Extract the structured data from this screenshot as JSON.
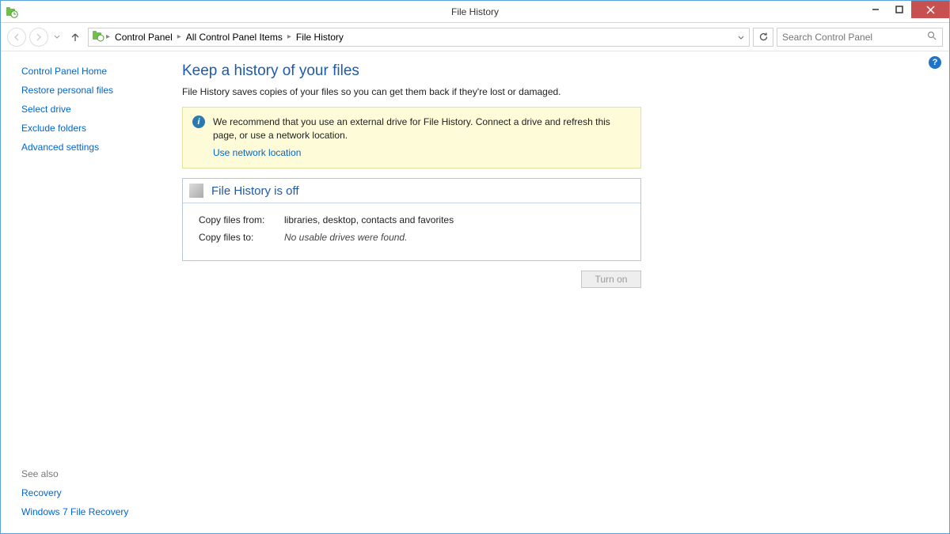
{
  "window": {
    "title": "File History"
  },
  "breadcrumbs": [
    "Control Panel",
    "All Control Panel Items",
    "File History"
  ],
  "search": {
    "placeholder": "Search Control Panel"
  },
  "sidebar": {
    "links": [
      "Control Panel Home",
      "Restore personal files",
      "Select drive",
      "Exclude folders",
      "Advanced settings"
    ],
    "see_also_header": "See also",
    "see_also": [
      "Recovery",
      "Windows 7 File Recovery"
    ]
  },
  "main": {
    "heading": "Keep a history of your files",
    "subheading": "File History saves copies of your files so you can get them back if they're lost or damaged.",
    "notice_text": "We recommend that you use an external drive for File History. Connect a drive and refresh this page, or use a network location.",
    "notice_link": "Use network location",
    "status_title": "File History is off",
    "copy_from_label": "Copy files from:",
    "copy_from_value": "libraries, desktop, contacts and favorites",
    "copy_to_label": "Copy files to:",
    "copy_to_value": "No usable drives were found.",
    "turn_on_label": "Turn on"
  }
}
